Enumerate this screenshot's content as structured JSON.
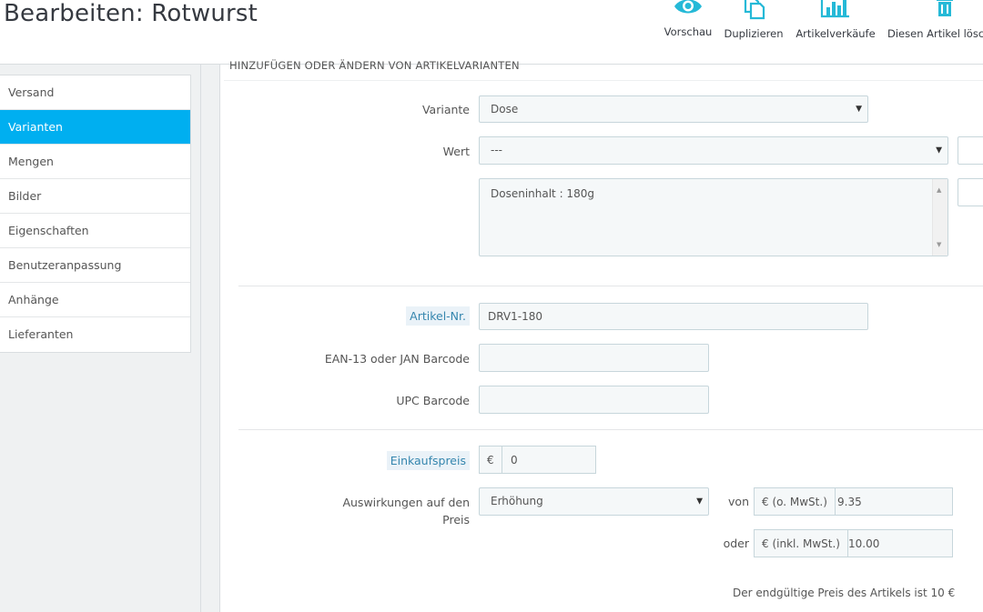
{
  "header": {
    "title": "Bearbeiten: Rotwurst",
    "toolbar": [
      {
        "label": "Vorschau",
        "icon": "eye-icon"
      },
      {
        "label": "Duplizieren",
        "icon": "duplicate-icon"
      },
      {
        "label": "Artikelverkäufe",
        "icon": "bar-chart-icon"
      },
      {
        "label": "Diesen Artikel lösch",
        "icon": "trash-icon"
      }
    ]
  },
  "sidebar": {
    "items": [
      {
        "label": "Versand"
      },
      {
        "label": "Varianten",
        "active": true
      },
      {
        "label": "Mengen"
      },
      {
        "label": "Bilder"
      },
      {
        "label": "Eigenschaften"
      },
      {
        "label": "Benutzeranpassung"
      },
      {
        "label": "Anhänge"
      },
      {
        "label": "Lieferanten"
      }
    ]
  },
  "panel": {
    "heading": "Hinzufügen oder Ändern von Artikelvarianten",
    "variante": {
      "label": "Variante",
      "value": "Dose"
    },
    "wert": {
      "label": "Wert",
      "value": "---"
    },
    "combination_list": "Doseninhalt : 180g",
    "artikel_nr": {
      "label": "Artikel-Nr.",
      "value": "DRV1-180"
    },
    "ean": {
      "label": "EAN-13 oder JAN Barcode",
      "value": ""
    },
    "upc": {
      "label": "UPC Barcode",
      "value": ""
    },
    "einkaufspreis": {
      "label": "Einkaufspreis",
      "prefix": "€",
      "value": "0"
    },
    "auswirkungen": {
      "label": "Auswirkungen auf den Preis",
      "value": "Erhöhung"
    },
    "von": {
      "label": "von",
      "prefix": "€ (o. MwSt.)",
      "value": "9.35"
    },
    "oder": {
      "label": "oder",
      "prefix": "€ (inkl. MwSt.)",
      "value": "10.00"
    },
    "final_price": "Der endgültige Preis des Artikels ist 10 €"
  },
  "colors": {
    "accent": "#00aff0",
    "icon": "#25b9d7",
    "label_highlight": "#3586ae"
  }
}
